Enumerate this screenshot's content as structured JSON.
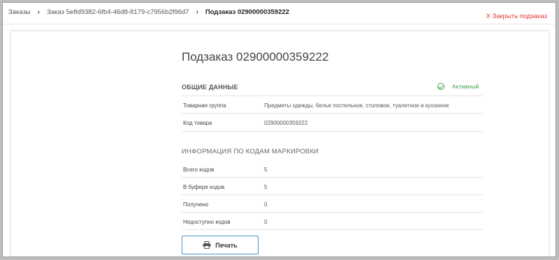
{
  "breadcrumb": {
    "orders": "Заказы",
    "order": "Заказ 5e8d9382-6fb4-46d8-8179-c7956b2f96d7",
    "current": "Подзаказ 02900000359222"
  },
  "header": {
    "close_label": "X Закрыть подзаказ"
  },
  "page": {
    "title": "Подзаказ 02900000359222"
  },
  "general": {
    "heading": "ОБЩИЕ ДАННЫЕ",
    "status": "Активный",
    "rows": [
      {
        "label": "Товарная группа",
        "value": "Предметы одежды, белье постельное, столовое, туалетное и кухонное"
      },
      {
        "label": "Код товара",
        "value": "02900000359222"
      }
    ]
  },
  "codes": {
    "heading": "ИНФОРМАЦИЯ ПО КОДАМ МАРКИРОВКИ",
    "rows": [
      {
        "label": "Всего кодов",
        "value": "5"
      },
      {
        "label": "В буфере кодов",
        "value": "5"
      },
      {
        "label": "Получено",
        "value": "0"
      },
      {
        "label": "Недоступно кодов",
        "value": "0"
      }
    ]
  },
  "actions": {
    "print_label": "Печать"
  },
  "colors": {
    "accent": "#4a90c2",
    "status": "#43a047",
    "close": "#e53935"
  }
}
